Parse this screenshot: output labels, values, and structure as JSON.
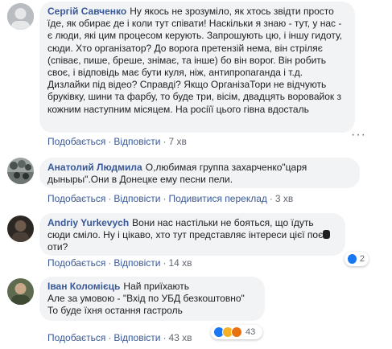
{
  "comments": [
    {
      "author": "Сергій Савченко",
      "text": "Ну якось не зрозуміло, як хтось звідти просто їде, як обирає де і коли тут співати! Наскільки я знаю - тут, у нас - є люди, які цим процесом керують. Запрошують цю, і іншу гидоту, сюди. Хто організатор? До ворога претензій нема, він стріляє (співає, пише, бреше, знімає, та інше) бо він ворог. Він робить своє, і відповідь має бути куля, ніж, антипропаганда і т.д. Дизлайки під відео? Справді? Якщо ОрганізаТори не відчують бруківку, шини та фарбу, то буде три, вісім, двадцять воровайок з кожним наступним місяцем. На росіїї цього гівна вдосталь",
      "like": "Подобається",
      "reply": "Відповісти",
      "time": "7 хв",
      "reaction_count": ""
    },
    {
      "author": "Анатолий Людмила",
      "text": "О,любимая группа захарченко\"царя дыныры\".Они в Донецке ему песни пели.",
      "like": "Подобається",
      "reply": "Відповісти",
      "translate": "Подивитися переклад",
      "time": "3 хв"
    },
    {
      "author": "Andriy Yurkevych",
      "text_before": "Вони нас настільки не бояться, що їдуть сюди сміло. Ну і цікаво, хто тут представляє інтереси цієї поє",
      "text_after": "оти?",
      "like": "Подобається",
      "reply": "Відповісти",
      "time": "14 хв",
      "reaction_count": "2"
    },
    {
      "author": "Іван Коломієць",
      "text_lines": [
        "Най приїхають",
        "Але за умовою - \"Вхід по УБД безкоштовно\"",
        "То буде їхня остання гастроль"
      ],
      "like": "Подобається",
      "reply": "Відповісти",
      "time": "43 хв",
      "reaction_count": "43"
    }
  ],
  "colors": {
    "name": "#385898",
    "bubble": "#f2f3f5",
    "meta": "#606770",
    "like": "#1877f2"
  }
}
